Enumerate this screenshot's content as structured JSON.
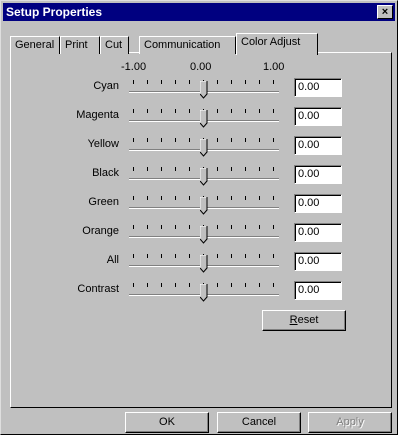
{
  "window": {
    "title": "Setup Properties",
    "close_glyph": "×"
  },
  "tabs": [
    {
      "label": "General"
    },
    {
      "label": "Print"
    },
    {
      "label": "Cut"
    },
    {
      "label": "Communication"
    },
    {
      "label": "Color Adjust",
      "active": true
    }
  ],
  "scale": {
    "min": "-1.00",
    "mid": "0.00",
    "max": "1.00"
  },
  "sliders": [
    {
      "label": "Cyan",
      "value": "0.00"
    },
    {
      "label": "Magenta",
      "value": "0.00"
    },
    {
      "label": "Yellow",
      "value": "0.00"
    },
    {
      "label": "Black",
      "value": "0.00"
    },
    {
      "label": "Green",
      "value": "0.00"
    },
    {
      "label": "Orange",
      "value": "0.00"
    },
    {
      "label": "All",
      "value": "0.00"
    },
    {
      "label": "Contrast",
      "value": "0.00"
    }
  ],
  "buttons": {
    "reset_mnemonic": "R",
    "reset_rest": "eset",
    "ok": "OK",
    "cancel": "Cancel",
    "apply": "Apply"
  }
}
